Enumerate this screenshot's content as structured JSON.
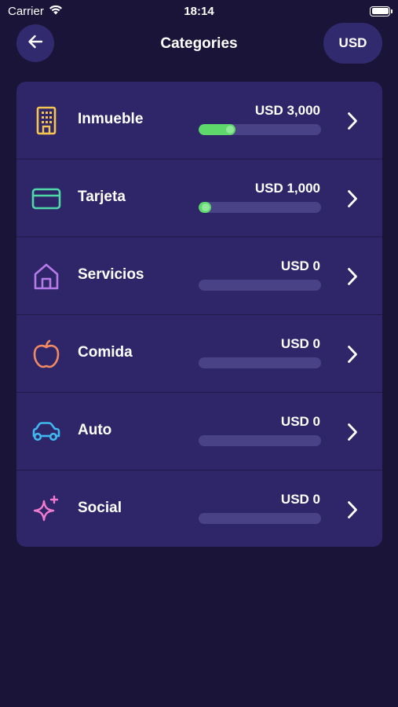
{
  "status_bar": {
    "carrier": "Carrier",
    "time": "18:14"
  },
  "header": {
    "title": "Categories",
    "currency": "USD"
  },
  "categories": [
    {
      "label": "Inmueble",
      "amount": "USD 3,000",
      "progress": 0.3,
      "icon": "building-icon",
      "color": "#f5c451"
    },
    {
      "label": "Tarjeta",
      "amount": "USD 1,000",
      "progress": 0.1,
      "icon": "credit-card-icon",
      "color": "#4fd9a8"
    },
    {
      "label": "Servicios",
      "amount": "USD 0",
      "progress": 0,
      "icon": "house-icon",
      "color": "#b67be8"
    },
    {
      "label": "Comida",
      "amount": "USD 0",
      "progress": 0,
      "icon": "apple-icon",
      "color": "#f08a62"
    },
    {
      "label": "Auto",
      "amount": "USD 0",
      "progress": 0,
      "icon": "car-icon",
      "color": "#3fb8f0"
    },
    {
      "label": "Social",
      "amount": "USD 0",
      "progress": 0,
      "icon": "sparkle-icon",
      "color": "#f27ad0"
    }
  ],
  "colors": {
    "background": "#1a1538",
    "card": "#2f2669",
    "button": "#322a6e",
    "progress_track": "#4a4287",
    "progress_fill": "#5ed86a"
  }
}
